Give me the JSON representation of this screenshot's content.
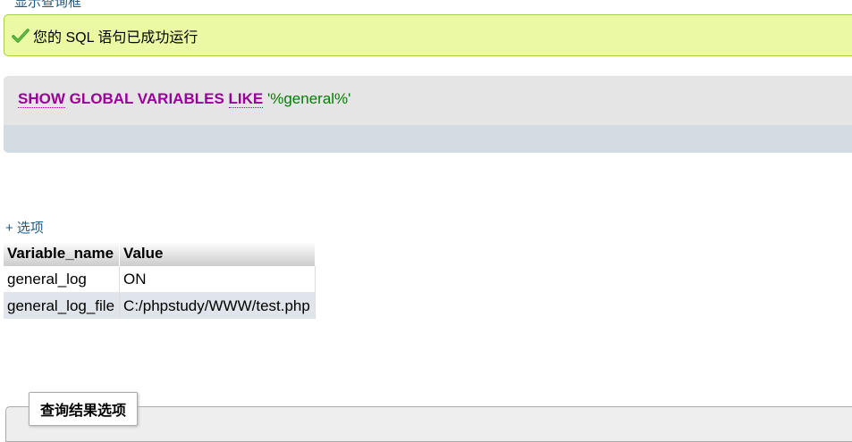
{
  "top_link": "显示查询框",
  "success": {
    "message": "您的 SQL 语句已成功运行",
    "icon": "check-icon"
  },
  "sql": {
    "kw_show": "SHOW",
    "kw_global_variables": "GLOBAL VARIABLES",
    "kw_like": "LIKE",
    "string": "'%general%'"
  },
  "options_link": "+ 选项",
  "table": {
    "headers": [
      "Variable_name",
      "Value"
    ],
    "rows": [
      [
        "general_log",
        "ON"
      ],
      [
        "general_log_file",
        "C:/phpstudy/WWW/test.php"
      ]
    ]
  },
  "query_results_legend": "查询结果选项",
  "colors": {
    "success_bg": "#ebf8a4",
    "keyword": "#990099",
    "string": "#008000",
    "link": "#235a81"
  }
}
